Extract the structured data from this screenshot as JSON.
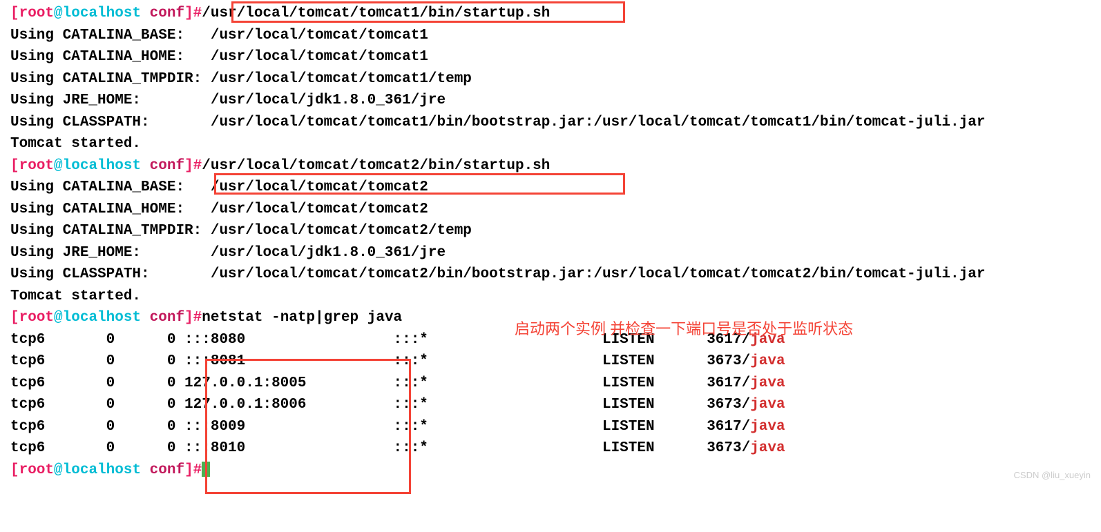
{
  "prompt1": {
    "open": "[",
    "user": "root",
    "at": "@localhost",
    "path": " conf",
    "close": "]#",
    "cmd": "/usr/local/tomcat/tomcat1/bin/startup.sh"
  },
  "tomcat1": {
    "l1": "Using CATALINA_BASE:   /usr/local/tomcat/tomcat1",
    "l2": "Using CATALINA_HOME:   /usr/local/tomcat/tomcat1",
    "l3": "Using CATALINA_TMPDIR: /usr/local/tomcat/tomcat1/temp",
    "l4": "Using JRE_HOME:        /usr/local/jdk1.8.0_361/jre",
    "l5": "Using CLASSPATH:       /usr/local/tomcat/tomcat1/bin/bootstrap.jar:/usr/local/tomcat/tomcat1/bin/tomcat-juli.jar",
    "l6": "Tomcat started."
  },
  "prompt2": {
    "open": "[",
    "user": "root",
    "at": "@localhost",
    "path": " conf",
    "close": "]#",
    "cmd": "/usr/local/tomcat/tomcat2/bin/startup.sh"
  },
  "tomcat2": {
    "l1": "Using CATALINA_BASE:   /usr/local/tomcat/tomcat2",
    "l2": "Using CATALINA_HOME:   /usr/local/tomcat/tomcat2",
    "l3": "Using CATALINA_TMPDIR: /usr/local/tomcat/tomcat2/temp",
    "l4": "Using JRE_HOME:        /usr/local/jdk1.8.0_361/jre",
    "l5": "Using CLASSPATH:       /usr/local/tomcat/tomcat2/bin/bootstrap.jar:/usr/local/tomcat/tomcat2/bin/tomcat-juli.jar",
    "l6": "Tomcat started."
  },
  "prompt3": {
    "open": "[",
    "user": "root",
    "at": "@localhost",
    "path": " conf",
    "close": "]#",
    "cmd": "netstat -natp|grep java"
  },
  "netstat": [
    {
      "proto": "tcp6       0      0 ",
      "addr": ":::8080                 ",
      "foreign": ":::*",
      "state": "                    LISTEN      ",
      "pid": "3617/",
      "prog": "java"
    },
    {
      "proto": "tcp6       0      0 ",
      "addr": ":::8081                 ",
      "foreign": ":::*",
      "state": "                    LISTEN      ",
      "pid": "3673/",
      "prog": "java"
    },
    {
      "proto": "tcp6       0      0 ",
      "addr": "127.0.0.1:8005          ",
      "foreign": ":::*",
      "state": "                    LISTEN      ",
      "pid": "3617/",
      "prog": "java"
    },
    {
      "proto": "tcp6       0      0 ",
      "addr": "127.0.0.1:8006          ",
      "foreign": ":::*",
      "state": "                    LISTEN      ",
      "pid": "3673/",
      "prog": "java"
    },
    {
      "proto": "tcp6       0      0 ",
      "addr": ":::8009                 ",
      "foreign": ":::*",
      "state": "                    LISTEN      ",
      "pid": "3617/",
      "prog": "java"
    },
    {
      "proto": "tcp6       0      0 ",
      "addr": ":::8010                 ",
      "foreign": ":::*",
      "state": "                    LISTEN      ",
      "pid": "3673/",
      "prog": "java"
    }
  ],
  "prompt4": {
    "open": "[",
    "user": "root",
    "at": "@localhost",
    "path": " conf",
    "close": "]#"
  },
  "annotation": "启动两个实例 并检查一下端口号是否处于监听状态",
  "watermark": "CSDN @liu_xueyin"
}
